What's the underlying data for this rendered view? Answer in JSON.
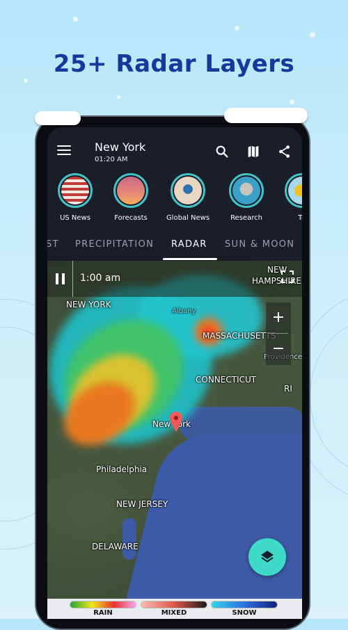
{
  "headline": "25+ Radar Layers",
  "app_bar": {
    "city": "New York",
    "time": "01:20 AM",
    "icons": [
      "menu-icon",
      "search-icon",
      "map-icon",
      "share-icon"
    ]
  },
  "stories": [
    {
      "label": "US News"
    },
    {
      "label": "Forecasts"
    },
    {
      "label": "Global News"
    },
    {
      "label": "Research"
    },
    {
      "label": "Tri"
    }
  ],
  "tabs": [
    {
      "label": "ST",
      "active": false
    },
    {
      "label": "PRECIPITATION",
      "active": false
    },
    {
      "label": "RADAR",
      "active": true
    },
    {
      "label": "SUN & MOON",
      "active": false
    }
  ],
  "map": {
    "timestamp": "1:00 am",
    "zoom_in": "+",
    "zoom_out": "−",
    "labels": {
      "new_york_state": "NEW YORK",
      "new_hampshire_1": "NEW",
      "new_hampshire_2": "HAMPSHIRE",
      "albany": "Albany",
      "massachusetts": "MASSACHUSETTS",
      "providence": "Providence",
      "connecticut": "CONNECTICUT",
      "ri": "RI",
      "new_york_city": "New York",
      "philadelphia": "Philadelphia",
      "new_jersey": "NEW JERSEY",
      "delaware": "DELAWARE"
    }
  },
  "legend": [
    {
      "label": "RAIN",
      "colors": [
        "#1fa53a",
        "#f2e51b",
        "#e8322e",
        "#f7a8f3"
      ]
    },
    {
      "label": "MIXED",
      "colors": [
        "#f5bdb3",
        "#e2574a",
        "#1c1c1c"
      ]
    },
    {
      "label": "SNOW",
      "colors": [
        "#31d6ee",
        "#2f6fe0",
        "#10237a"
      ]
    }
  ]
}
